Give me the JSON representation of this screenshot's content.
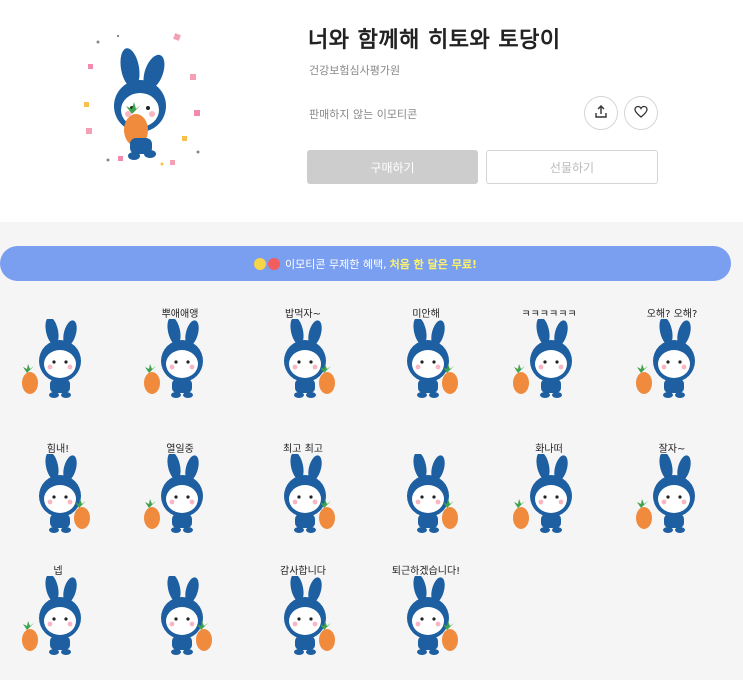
{
  "product": {
    "title": "너와 함께해 히토와 토당이",
    "author": "건강보험심사평가원",
    "sale_status": "판매하지 않는 이모티콘",
    "buy_label": "구매하기",
    "gift_label": "선물하기",
    "share_icon": "share-icon",
    "like_icon": "heart-icon"
  },
  "banner": {
    "text": "이모티콘 무제한 혜택,",
    "highlight": "처음 한 달은 무료!"
  },
  "stickers": [
    {
      "caption": ""
    },
    {
      "caption": "뿌애애앵"
    },
    {
      "caption": "밥먹자~"
    },
    {
      "caption": "미안해"
    },
    {
      "caption": "ㅋㅋㅋㅋㅋㅋ"
    },
    {
      "caption": "오해? 오해?"
    },
    {
      "caption": "힘내!"
    },
    {
      "caption": "열일중"
    },
    {
      "caption": "최고 최고"
    },
    {
      "caption": ""
    },
    {
      "caption": "화나떠"
    },
    {
      "caption": "잘자~"
    },
    {
      "caption": "넵"
    },
    {
      "caption": ""
    },
    {
      "caption": "감사합니다"
    },
    {
      "caption": "퇴근하겠습니다!"
    }
  ],
  "colors": {
    "banner": "#7a9ff0",
    "highlight": "#fff36a",
    "character_blue": "#1d5fa0",
    "carrot": "#f08a3c"
  }
}
